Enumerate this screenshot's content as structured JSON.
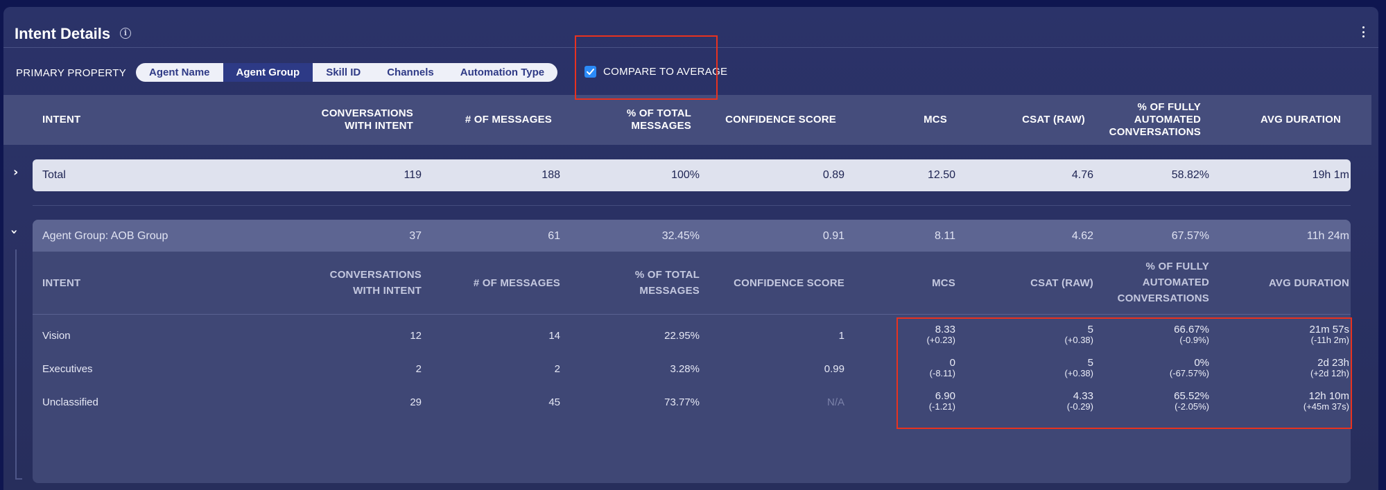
{
  "header": {
    "title": "Intent Details",
    "info_icon": "info-circle-icon",
    "menu_icon": "kebab-menu-icon"
  },
  "toolbar": {
    "primary_property_label": "PRIMARY PROPERTY",
    "options": [
      "Agent Name",
      "Agent Group",
      "Skill ID",
      "Channels",
      "Automation Type"
    ],
    "selected": "Agent Group",
    "compare_label": "COMPARE TO AVERAGE",
    "compare_checked": true
  },
  "table": {
    "columns": [
      "INTENT",
      "CONVERSATIONS WITH INTENT",
      "# OF MESSAGES",
      "% OF TOTAL MESSAGES",
      "CONFIDENCE SCORE",
      "MCS",
      "CSAT (RAW)",
      "% OF FULLY AUTOMATED CONVERSATIONS",
      "AVG DURATION"
    ],
    "col_lines": {
      "conv": [
        "CONVERSATIONS",
        "WITH INTENT"
      ],
      "pct": [
        "% OF TOTAL",
        "MESSAGES"
      ],
      "auto": [
        "% OF FULLY",
        "AUTOMATED",
        "CONVERSATIONS"
      ]
    },
    "total": {
      "label": "Total",
      "conversations": "119",
      "messages": "188",
      "pct_total": "100%",
      "confidence": "0.89",
      "mcs": "12.50",
      "csat": "4.76",
      "fully_automated": "58.82%",
      "avg_duration": "19h 1m"
    },
    "group": {
      "label": "Agent Group: AOB Group",
      "conversations": "37",
      "messages": "61",
      "pct_total": "32.45%",
      "confidence": "0.91",
      "mcs": "8.11",
      "csat": "4.62",
      "fully_automated": "67.57%",
      "avg_duration": "11h 24m",
      "rows": [
        {
          "intent": "Vision",
          "conversations": "12",
          "messages": "14",
          "pct_total": "22.95%",
          "confidence": "1",
          "mcs": "8.33",
          "mcs_delta": "(+0.23)",
          "csat": "5",
          "csat_delta": "(+0.38)",
          "fully_automated": "66.67%",
          "fully_automated_delta": "(-0.9%)",
          "avg_duration": "21m 57s",
          "avg_duration_delta": "(-11h 2m)"
        },
        {
          "intent": "Executives",
          "conversations": "2",
          "messages": "2",
          "pct_total": "3.28%",
          "confidence": "0.99",
          "mcs": "0",
          "mcs_delta": "(-8.11)",
          "csat": "5",
          "csat_delta": "(+0.38)",
          "fully_automated": "0%",
          "fully_automated_delta": "(-67.57%)",
          "avg_duration": "2d 23h",
          "avg_duration_delta": "(+2d 12h)"
        },
        {
          "intent": "Unclassified",
          "conversations": "29",
          "messages": "45",
          "pct_total": "73.77%",
          "confidence": "N/A",
          "mcs": "6.90",
          "mcs_delta": "(-1.21)",
          "csat": "4.33",
          "csat_delta": "(-0.29)",
          "fully_automated": "65.52%",
          "fully_automated_delta": "(-2.05%)",
          "avg_duration": "12h 10m",
          "avg_duration_delta": "(+45m 37s)"
        }
      ]
    }
  },
  "colors": {
    "background": "#0f1650",
    "panel": "#2b3369",
    "accent": "#2d3a86",
    "checkbox": "#2b8af7",
    "highlight_box": "#e8321f"
  }
}
